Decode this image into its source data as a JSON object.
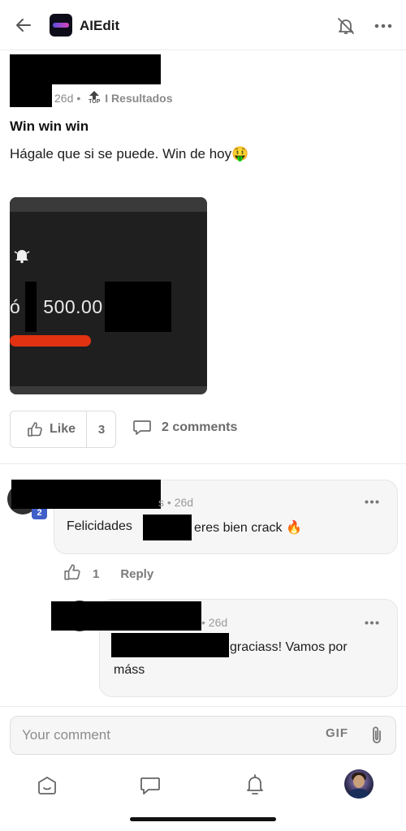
{
  "header": {
    "app_title": "AIEdit",
    "icons": [
      "back-arrow-icon",
      "app-logo-icon",
      "notifications-off-icon",
      "more-horizontal-icon"
    ]
  },
  "post": {
    "time": "26d",
    "separator": "•",
    "top_label": "TOP",
    "category": "I Resultados",
    "title": "Win win win",
    "body": "Hágale que si se puede. Win de hoy🤑",
    "image": {
      "amount_prefix": "ó",
      "amount": "500.00"
    },
    "like_label": "Like",
    "like_count": "3",
    "comments_label": "2 comments"
  },
  "comments": [
    {
      "name_tail": "s",
      "time": "26d",
      "level": "2",
      "text_before": "Felicidades",
      "text_after": "eres bien crack 🔥",
      "like_count": "1",
      "reply_label": "Reply"
    },
    {
      "time": "26d",
      "text_line1": "graciass! Vamos por",
      "text_line2": "máss"
    }
  ],
  "composer": {
    "placeholder": "Your comment",
    "gif_label": "GIF"
  },
  "colors": {
    "redaction": "#000000",
    "level_badge": "#3f5fc9",
    "accent_text": "#6b6b6b"
  }
}
